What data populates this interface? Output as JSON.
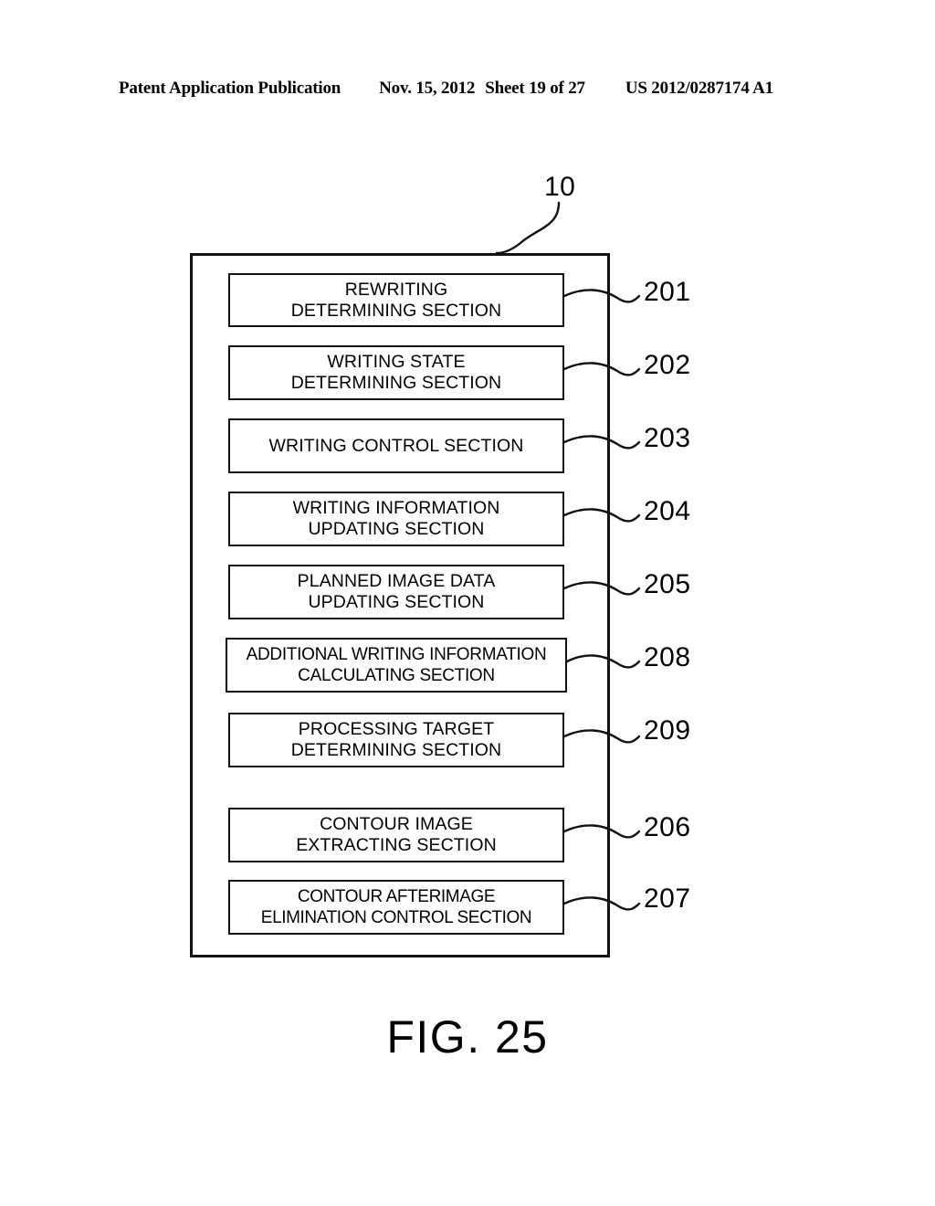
{
  "header": {
    "publication": "Patent Application Publication",
    "date": "Nov. 15, 2012",
    "sheet": "Sheet 19 of 27",
    "document_number": "US 2012/0287174 A1"
  },
  "figure": {
    "caption": "FIG. 25",
    "enclosure_label": "10",
    "blocks": [
      {
        "ref": "201",
        "label": "REWRITING\nDETERMINING SECTION"
      },
      {
        "ref": "202",
        "label": "WRITING STATE\nDETERMINING SECTION"
      },
      {
        "ref": "203",
        "label": "WRITING CONTROL SECTION"
      },
      {
        "ref": "204",
        "label": "WRITING INFORMATION\nUPDATING SECTION"
      },
      {
        "ref": "205",
        "label": "PLANNED IMAGE DATA\nUPDATING SECTION"
      },
      {
        "ref": "208",
        "label": "ADDITIONAL WRITING INFORMATION\nCALCULATING SECTION"
      },
      {
        "ref": "209",
        "label": "PROCESSING TARGET\nDETERMINING SECTION"
      },
      {
        "ref": "206",
        "label": "CONTOUR IMAGE\nEXTRACTING SECTION"
      },
      {
        "ref": "207",
        "label": "CONTOUR AFTERIMAGE\nELIMINATION CONTROL SECTION"
      }
    ]
  },
  "colors": {
    "ink": "#111111",
    "paper": "#ffffff"
  }
}
